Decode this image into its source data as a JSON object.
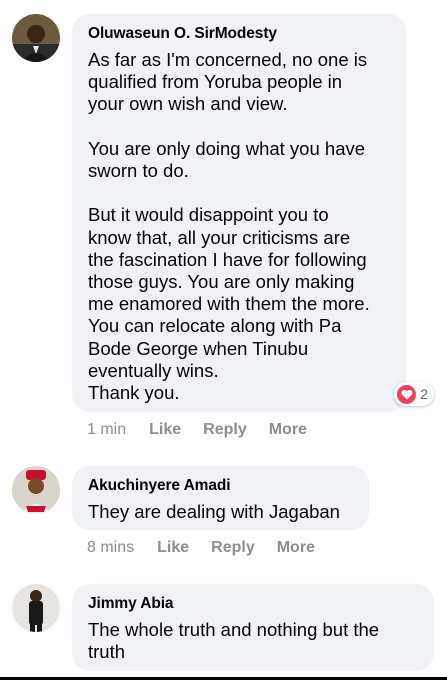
{
  "comments": [
    {
      "author": "Oluwaseun O. SirModesty",
      "text": "As far as I'm concerned, no one is\nqualified from Yoruba people in\nyour own wish and view.\n\nYou are only doing what you have\nsworn to do.\n\nBut it would disappoint you to\nknow that, all your criticisms are\nthe fascination I have for following\nthose guys. You are only making\nme enamored with them the more.\nYou can relocate along with Pa\nBode George when Tinubu\neventually wins.\nThank you.",
      "time": "1 min",
      "like_label": "Like",
      "reply_label": "Reply",
      "more_label": "More",
      "reaction_icon": "heart-love-icon",
      "reaction_count": "2",
      "reaction_color": "#f33e58"
    },
    {
      "author": "Akuchinyere Amadi",
      "text": "They are dealing with Jagaban",
      "time": "8 mins",
      "like_label": "Like",
      "reply_label": "Reply",
      "more_label": "More"
    },
    {
      "author": "Jimmy Abia",
      "text": "The whole truth and nothing but the\ntruth"
    }
  ],
  "colors": {
    "bubble": "#f0f2f5",
    "meta_text": "#8a8d91",
    "author_text": "#050505"
  }
}
